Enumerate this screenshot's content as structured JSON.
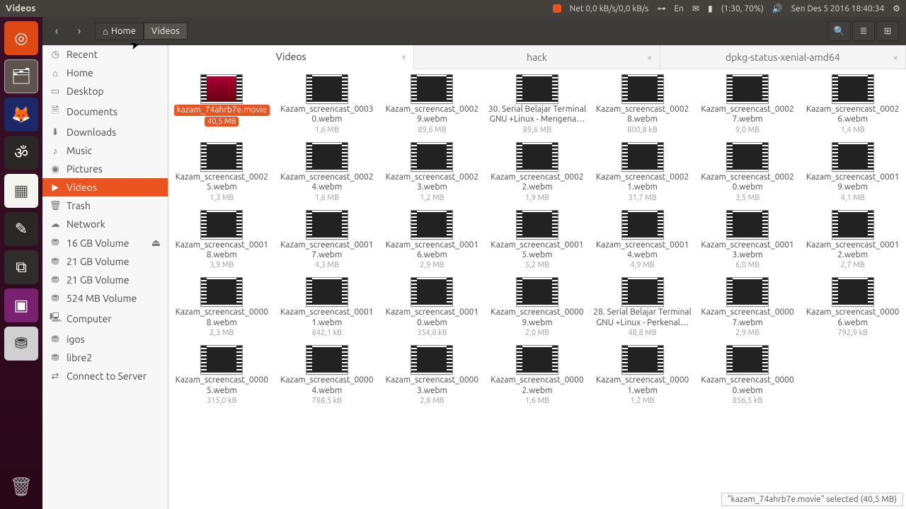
{
  "menubar": {
    "title": "Videos"
  },
  "indicators": {
    "net": "Net 0,0 kB/s/0,0 kB/s",
    "lang": "En",
    "battery": "(1:30, 70%)",
    "datetime": "Sen Des  5 2016 18:40:34"
  },
  "toolbar": {
    "back": "‹",
    "forward": "›",
    "home_label": "Home",
    "path_label": "Videos"
  },
  "sidebar": [
    {
      "icon": "◷",
      "label": "Recent",
      "active": false
    },
    {
      "icon": "⌂",
      "label": "Home",
      "active": false
    },
    {
      "icon": "▭",
      "label": "Desktop",
      "active": false
    },
    {
      "icon": "🗎",
      "label": "Documents",
      "active": false
    },
    {
      "icon": "⬇",
      "label": "Downloads",
      "active": false
    },
    {
      "icon": "♪",
      "label": "Music",
      "active": false
    },
    {
      "icon": "◉",
      "label": "Pictures",
      "active": false
    },
    {
      "icon": "▶",
      "label": "Videos",
      "active": true
    },
    {
      "icon": "🗑",
      "label": "Trash",
      "active": false
    },
    {
      "icon": "☁",
      "label": "Network",
      "active": false
    },
    {
      "icon": "⛃",
      "label": "16 GB Volume",
      "active": false,
      "eject": true
    },
    {
      "icon": "⛃",
      "label": "21 GB Volume",
      "active": false
    },
    {
      "icon": "⛃",
      "label": "21 GB Volume",
      "active": false
    },
    {
      "icon": "⛃",
      "label": "524 MB Volume",
      "active": false
    },
    {
      "icon": "🖳",
      "label": "Computer",
      "active": false
    },
    {
      "icon": "⛃",
      "label": "igos",
      "active": false
    },
    {
      "icon": "⛃",
      "label": "libre2",
      "active": false
    },
    {
      "icon": "⇄",
      "label": "Connect to Server",
      "active": false
    }
  ],
  "tabs": [
    {
      "label": "Videos",
      "active": true
    },
    {
      "label": "hack",
      "active": false
    },
    {
      "label": "dpkg-status-xenial-amd64",
      "active": false
    }
  ],
  "files": [
    {
      "name": "kazam_74ahrb7e.movie",
      "size": "40,5 MB",
      "selected": true
    },
    {
      "name": "Kazam_screencast_00030.webm",
      "size": "1,6 MB"
    },
    {
      "name": "Kazam_screencast_00029.webm",
      "size": "89,6 MB"
    },
    {
      "name": "30. Serial Belajar Terminal GNU +Linux - Mengena…",
      "size": "89,6 MB"
    },
    {
      "name": "Kazam_screencast_00028.webm",
      "size": "800,8 kB"
    },
    {
      "name": "Kazam_screencast_00027.webm",
      "size": "9,0 MB"
    },
    {
      "name": "Kazam_screencast_00026.webm",
      "size": "1,4 MB"
    },
    {
      "name": "Kazam_screencast_00025.webm",
      "size": "1,3 MB"
    },
    {
      "name": "Kazam_screencast_00024.webm",
      "size": "1,6 MB"
    },
    {
      "name": "Kazam_screencast_00023.webm",
      "size": "1,2 MB"
    },
    {
      "name": "Kazam_screencast_00022.webm",
      "size": "1,9 MB"
    },
    {
      "name": "Kazam_screencast_00021.webm",
      "size": "31,7 MB"
    },
    {
      "name": "Kazam_screencast_00020.webm",
      "size": "3,5 MB"
    },
    {
      "name": "Kazam_screencast_00019.webm",
      "size": "4,1 MB"
    },
    {
      "name": "Kazam_screencast_00018.webm",
      "size": "3,9 MB"
    },
    {
      "name": "Kazam_screencast_00017.webm",
      "size": "4,3 MB"
    },
    {
      "name": "Kazam_screencast_00016.webm",
      "size": "2,9 MB"
    },
    {
      "name": "Kazam_screencast_00015.webm",
      "size": "5,2 MB"
    },
    {
      "name": "Kazam_screencast_00014.webm",
      "size": "4,9 MB"
    },
    {
      "name": "Kazam_screencast_00013.webm",
      "size": "6,0 MB"
    },
    {
      "name": "Kazam_screencast_00012.webm",
      "size": "2,7 MB"
    },
    {
      "name": "Kazam_screencast_00008.webm",
      "size": "2,3 MB"
    },
    {
      "name": "Kazam_screencast_00011.webm",
      "size": "842,1 kB"
    },
    {
      "name": "Kazam_screencast_00010.webm",
      "size": "354,8 kB"
    },
    {
      "name": "Kazam_screencast_00009.webm",
      "size": "2,0 MB"
    },
    {
      "name": "28. Serial Belajar Terminal GNU +Linux - Perkenal…",
      "size": "48,8 MB"
    },
    {
      "name": "Kazam_screencast_00007.webm",
      "size": "2,9 MB"
    },
    {
      "name": "Kazam_screencast_00006.webm",
      "size": "792,9 kB"
    },
    {
      "name": "Kazam_screencast_00005.webm",
      "size": "315,0 kB"
    },
    {
      "name": "Kazam_screencast_00004.webm",
      "size": "788,5 kB"
    },
    {
      "name": "Kazam_screencast_00003.webm",
      "size": "2,8 MB"
    },
    {
      "name": "Kazam_screencast_00002.webm",
      "size": "1,6 MB"
    },
    {
      "name": "Kazam_screencast_00001.webm",
      "size": "1,2 MB"
    },
    {
      "name": "Kazam_screencast_00000.webm",
      "size": "856,5 kB"
    }
  ],
  "status": "\"kazam_74ahrb7e.movie\" selected  (40,5 MB)"
}
